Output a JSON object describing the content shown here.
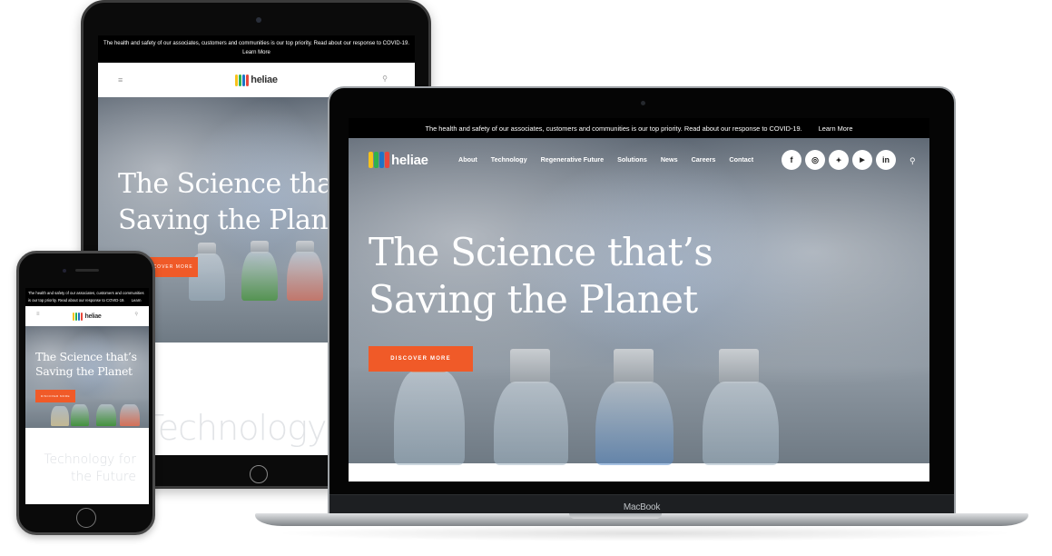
{
  "brand": {
    "name": "heliae",
    "logo_colors": [
      "#f7c21b",
      "#2fb24c",
      "#1f73c6",
      "#e9473b"
    ],
    "accent": "#f05a28"
  },
  "banner": {
    "text": "The health and safety of our associates, customers and communities is our top priority. Read about our response to COVID-19.",
    "link": "Learn More"
  },
  "nav": {
    "items": [
      "About",
      "Technology",
      "Regenerative Future",
      "Solutions",
      "News",
      "Careers",
      "Contact"
    ],
    "social": [
      {
        "name": "facebook",
        "glyph": "f"
      },
      {
        "name": "instagram",
        "glyph": "◎"
      },
      {
        "name": "twitter",
        "glyph": "🐦"
      },
      {
        "name": "youtube",
        "glyph": "▶"
      },
      {
        "name": "linkedin",
        "glyph": "in"
      }
    ],
    "search_glyph": "⚲",
    "menu_glyph": "≡"
  },
  "hero": {
    "title_line1": "The Science that’s",
    "title_line2": "Saving the Planet",
    "cta": "DISCOVER MORE"
  },
  "section": {
    "tablet_heading": "Technology",
    "phone_heading_line1": "Technology for",
    "phone_heading_line2": "the Future"
  },
  "devices": {
    "laptop_label": "MacBook"
  }
}
